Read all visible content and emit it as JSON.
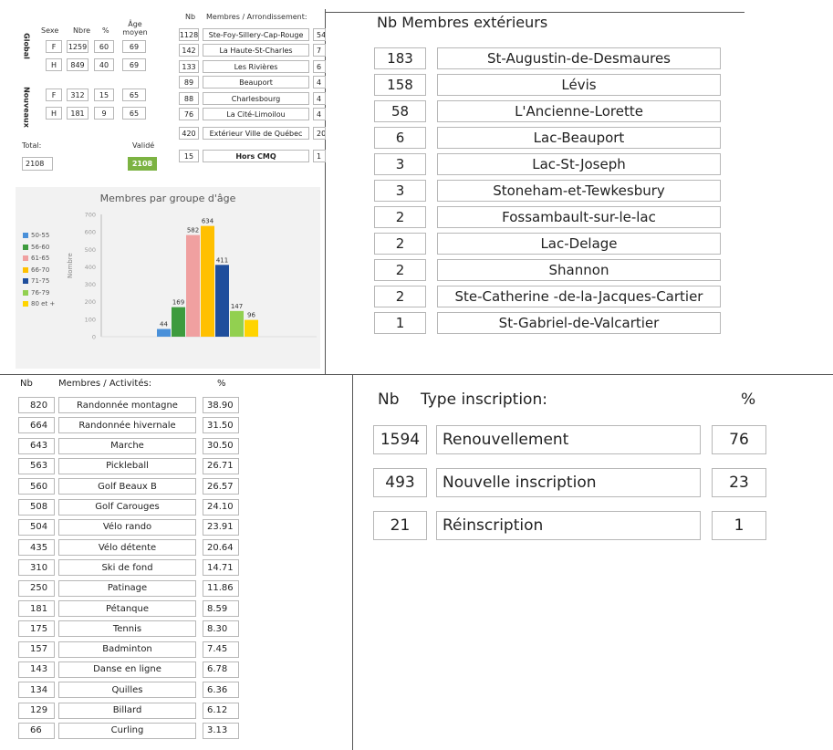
{
  "global_stats": {
    "headers": {
      "sexe": "Sexe",
      "nbre": "Nbre",
      "pct": "%",
      "age": "Âge moyen"
    },
    "global_label": "Global",
    "nouveaux_label": "Nouveaux",
    "rows": [
      {
        "sexe": "F",
        "nbre": "1259",
        "pct": "60",
        "age": "69"
      },
      {
        "sexe": "H",
        "nbre": "849",
        "pct": "40",
        "age": "69"
      },
      {
        "sexe": "F",
        "nbre": "312",
        "pct": "15",
        "age": "65"
      },
      {
        "sexe": "H",
        "nbre": "181",
        "pct": "9",
        "age": "65"
      }
    ],
    "total_label": "Total:",
    "total_value": "2108",
    "valide_label": "Validé",
    "valide_value": "2108"
  },
  "arrondissements": {
    "header_nb": "Nb",
    "header_name": "Membres / Arrondissement:",
    "rows": [
      {
        "nb": "1128",
        "name": "Ste-Foy-Sillery-Cap-Rouge",
        "pct": "54"
      },
      {
        "nb": "142",
        "name": "La Haute-St-Charles",
        "pct": "7"
      },
      {
        "nb": "133",
        "name": "Les Rivières",
        "pct": "6"
      },
      {
        "nb": "89",
        "name": "Beauport",
        "pct": "4"
      },
      {
        "nb": "88",
        "name": "Charlesbourg",
        "pct": "4"
      },
      {
        "nb": "76",
        "name": "La Cité-Limoilou",
        "pct": "4"
      },
      {
        "nb": "420",
        "name": "Extérieur Ville de Québec",
        "pct": "20"
      },
      {
        "nb": "15",
        "name": "Hors CMQ",
        "pct": "1"
      }
    ]
  },
  "chart_data": {
    "type": "bar",
    "title": "Membres par groupe d'âge",
    "ylabel": "Nombre",
    "ylim": [
      0,
      700
    ],
    "yticks": [
      "0",
      "100",
      "200",
      "300",
      "400",
      "500",
      "600",
      "700"
    ],
    "categories": [
      "50-55",
      "56-60",
      "61-65",
      "66-70",
      "71-75",
      "76-79",
      "80 et +"
    ],
    "values": [
      44,
      169,
      582,
      634,
      411,
      147,
      96
    ],
    "colors": [
      "#4a90d9",
      "#3e9b3e",
      "#f0a0a0",
      "#ffc000",
      "#1f4e9c",
      "#92d050",
      "#ffd400"
    ],
    "legend_position": "left",
    "grid": false
  },
  "exterieurs": {
    "header": "Nb Membres extérieurs",
    "rows": [
      {
        "nb": "183",
        "name": "St-Augustin-de-Desmaures"
      },
      {
        "nb": "158",
        "name": "Lévis"
      },
      {
        "nb": "58",
        "name": "L'Ancienne-Lorette"
      },
      {
        "nb": "6",
        "name": "Lac-Beauport"
      },
      {
        "nb": "3",
        "name": "Lac-St-Joseph"
      },
      {
        "nb": "3",
        "name": "Stoneham-et-Tewkesbury"
      },
      {
        "nb": "2",
        "name": "Fossambault-sur-le-lac"
      },
      {
        "nb": "2",
        "name": "Lac-Delage"
      },
      {
        "nb": "2",
        "name": "Shannon"
      },
      {
        "nb": "2",
        "name": "Ste-Catherine -de-la-Jacques-Cartier"
      },
      {
        "nb": "1",
        "name": "St-Gabriel-de-Valcartier"
      }
    ]
  },
  "activites": {
    "header_nb": "Nb",
    "header_name": "Membres / Activités:",
    "header_pct": "%",
    "rows": [
      {
        "nb": "820",
        "name": "Randonnée montagne",
        "pct": "38.90"
      },
      {
        "nb": "664",
        "name": "Randonnée hivernale",
        "pct": "31.50"
      },
      {
        "nb": "643",
        "name": "Marche",
        "pct": "30.50"
      },
      {
        "nb": "563",
        "name": "Pickleball",
        "pct": "26.71"
      },
      {
        "nb": "560",
        "name": "Golf Beaux B",
        "pct": "26.57"
      },
      {
        "nb": "508",
        "name": "Golf Carouges",
        "pct": "24.10"
      },
      {
        "nb": "504",
        "name": "Vélo rando",
        "pct": "23.91"
      },
      {
        "nb": "435",
        "name": "Vélo détente",
        "pct": "20.64"
      },
      {
        "nb": "310",
        "name": "Ski de fond",
        "pct": "14.71"
      },
      {
        "nb": "250",
        "name": "Patinage",
        "pct": "11.86"
      },
      {
        "nb": "181",
        "name": "Pétanque",
        "pct": "8.59"
      },
      {
        "nb": "175",
        "name": "Tennis",
        "pct": "8.30"
      },
      {
        "nb": "157",
        "name": "Badminton",
        "pct": "7.45"
      },
      {
        "nb": "143",
        "name": "Danse en ligne",
        "pct": "6.78"
      },
      {
        "nb": "134",
        "name": "Quilles",
        "pct": "6.36"
      },
      {
        "nb": "129",
        "name": "Billard",
        "pct": "6.12"
      },
      {
        "nb": "66",
        "name": "Curling",
        "pct": "3.13"
      }
    ]
  },
  "inscriptions": {
    "header_nb": "Nb",
    "header_type": "Type inscription:",
    "header_pct": "%",
    "rows": [
      {
        "nb": "1594",
        "type": "Renouvellement",
        "pct": "76"
      },
      {
        "nb": "493",
        "type": "Nouvelle inscription",
        "pct": "23"
      },
      {
        "nb": "21",
        "type": "Réinscription",
        "pct": "1"
      }
    ]
  }
}
